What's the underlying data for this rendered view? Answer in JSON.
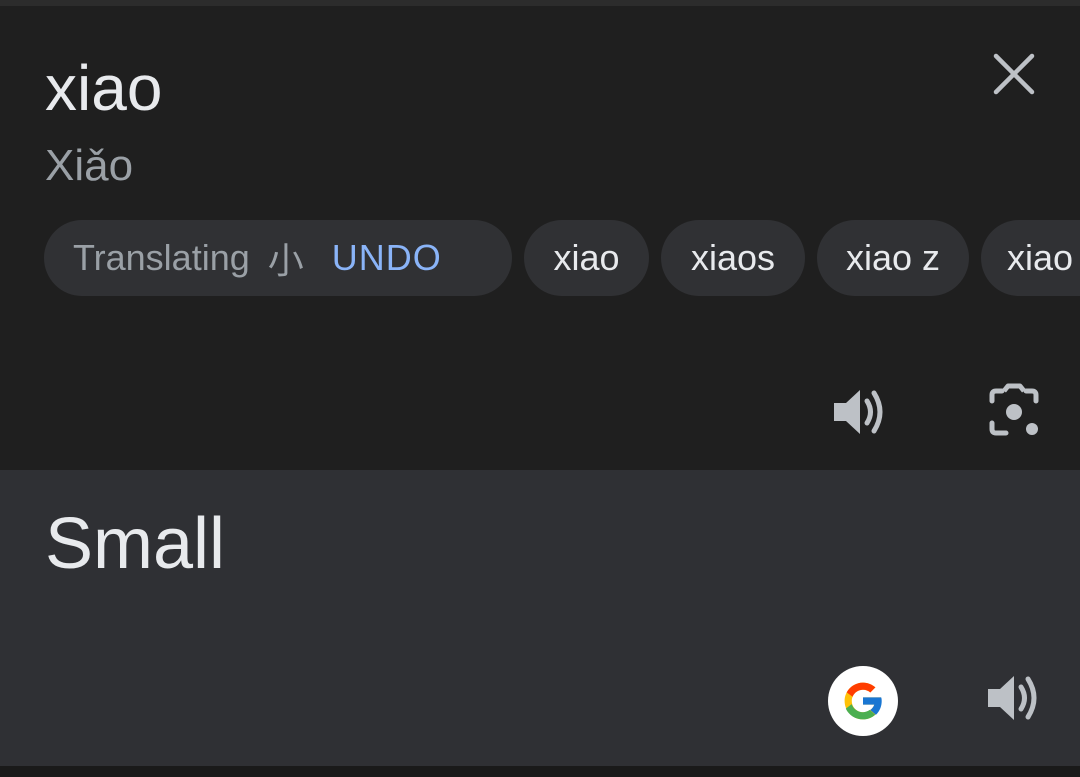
{
  "source": {
    "text": "xiao",
    "romanization": "Xiǎo"
  },
  "translating_chip": {
    "label": "Translating",
    "character": "小",
    "undo_label": "UNDO"
  },
  "suggestions": [
    "xiao",
    "xiaos",
    "xiao z",
    "xiao"
  ],
  "target": {
    "text": "Small"
  },
  "icons": {
    "close": "close-icon",
    "source_speaker": "speaker-icon",
    "camera": "camera-icon",
    "google": "google-logo-icon",
    "target_speaker": "speaker-icon"
  },
  "colors": {
    "background": "#1f1f1f",
    "target_panel": "#2f3034",
    "chip": "#303134",
    "accent": "#8ab4f8",
    "text_primary": "#e8eaed",
    "text_secondary": "#9aa0a6"
  }
}
